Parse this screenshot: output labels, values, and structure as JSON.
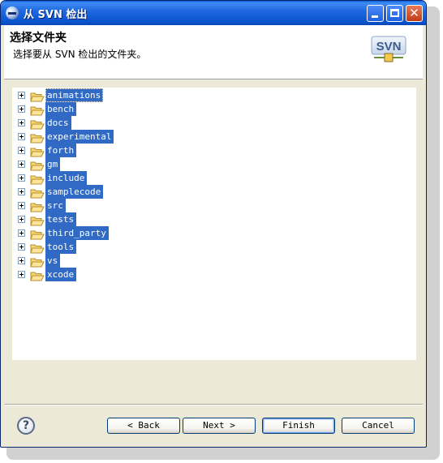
{
  "window": {
    "title": "从 SVN 检出"
  },
  "header": {
    "title": "选择文件夹",
    "subtitle": "选择要从 SVN 检出的文件夹。",
    "logo_text": "SVN"
  },
  "tree": {
    "items": [
      {
        "label": "animations"
      },
      {
        "label": "bench"
      },
      {
        "label": "docs"
      },
      {
        "label": "experimental"
      },
      {
        "label": "forth"
      },
      {
        "label": "gm"
      },
      {
        "label": "include"
      },
      {
        "label": "samplecode"
      },
      {
        "label": "src"
      },
      {
        "label": "tests"
      },
      {
        "label": "third_party"
      },
      {
        "label": "tools"
      },
      {
        "label": "vs"
      },
      {
        "label": "xcode"
      }
    ]
  },
  "buttons": {
    "help": "?",
    "back": "Back",
    "back_arrow": "<",
    "next": "Next",
    "next_arrow": ">",
    "finish": "Finish",
    "cancel": "Cancel"
  },
  "colors": {
    "selection": "#316ac5",
    "titlebar": "#0a54cf",
    "dialog_bg": "#ece9d8"
  }
}
